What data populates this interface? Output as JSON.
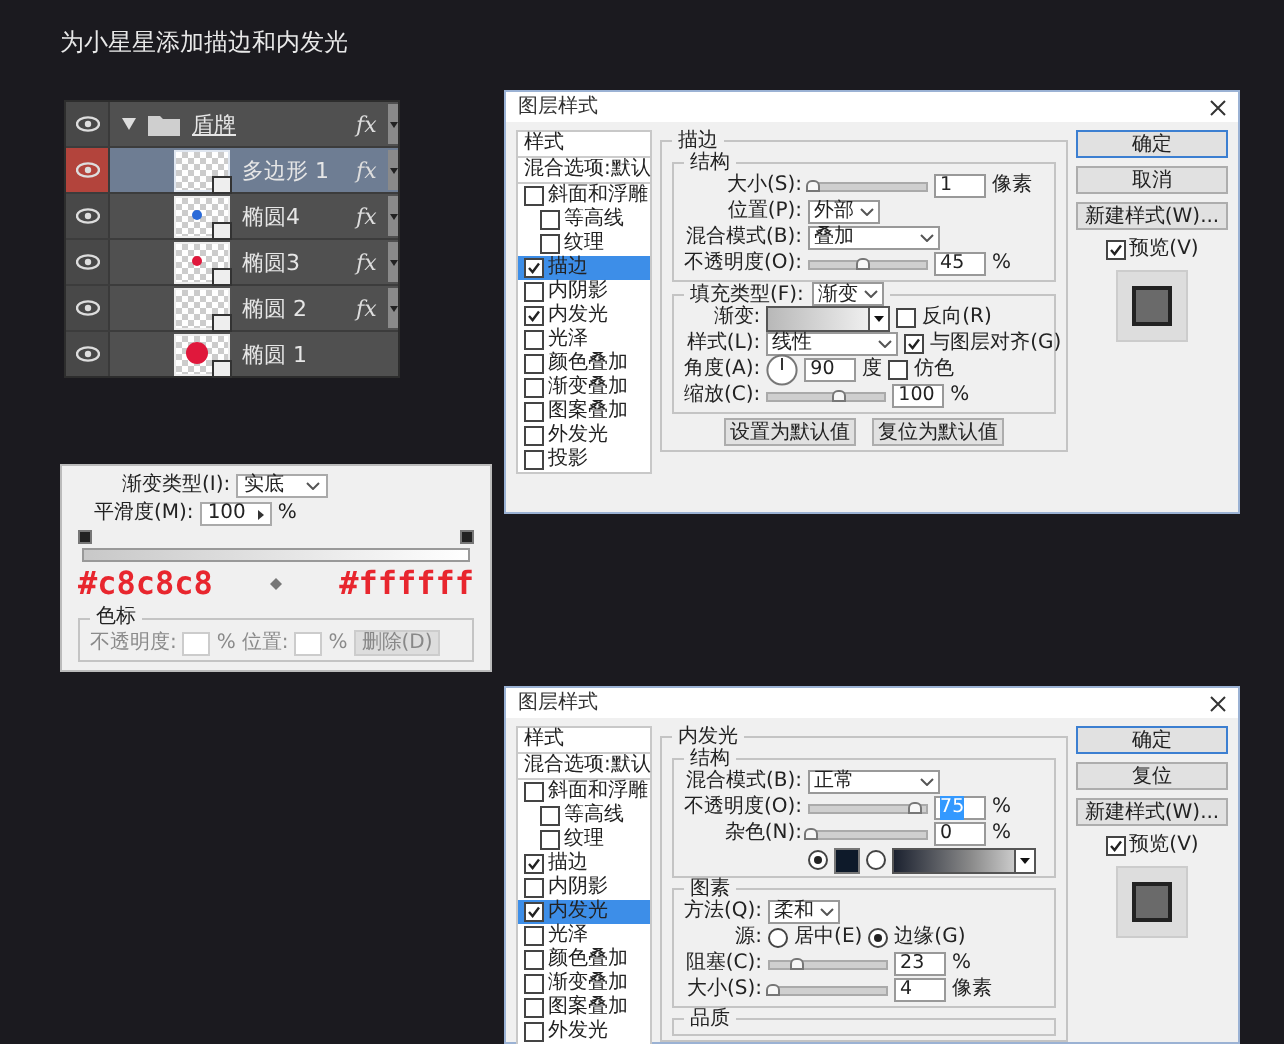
{
  "heading": "为小星星添加描边和内发光",
  "layers": [
    {
      "kind": "group",
      "name": "盾牌",
      "expanded": true,
      "selected": false,
      "fx": "fx",
      "children": [
        {
          "kind": "layer",
          "name": "多边形 1",
          "selected": true,
          "fx": "fx",
          "thumbnail": {
            "kind": "shape"
          }
        },
        {
          "kind": "layer",
          "name": "椭圆4",
          "selected": false,
          "fx": "fx",
          "thumbnail": {
            "kind": "dot",
            "color": "#2a6ad8"
          }
        },
        {
          "kind": "layer",
          "name": "椭圆3",
          "selected": false,
          "fx": "fx",
          "thumbnail": {
            "kind": "dot",
            "color": "#e0183c"
          }
        },
        {
          "kind": "layer",
          "name": "椭圆 2",
          "selected": false,
          "fx": "fx",
          "thumbnail": {
            "kind": "blank"
          }
        },
        {
          "kind": "layer",
          "name": "椭圆 1",
          "selected": false,
          "thumbnail": {
            "kind": "disc",
            "color": "#e0183c"
          }
        }
      ]
    }
  ],
  "gradient_editor": {
    "type_label": "渐变类型(I):",
    "type_value": "实底",
    "smoothness_label": "平滑度(M):",
    "smoothness_value": "100",
    "smoothness_unit": "%",
    "start_color": "#c8c8c8",
    "end_color": "#ffffff",
    "stops_legend": "色标",
    "opacity_label": "不透明度:",
    "opacity_unit": "%",
    "location_label": "位置:",
    "location_unit": "%",
    "delete_button": "删除(D)"
  },
  "dialogs": [
    {
      "title": "图层样式",
      "styles": [
        {
          "kind": "header",
          "label": "样式",
          "selected": false
        },
        {
          "kind": "header",
          "label": "混合选项:默认",
          "selected": false
        },
        {
          "kind": "checkbox",
          "label": "斜面和浮雕",
          "checked": false,
          "selected": false,
          "children": [
            {
              "kind": "checkbox",
              "label": "等高线",
              "checked": false,
              "selected": false
            },
            {
              "kind": "checkbox",
              "label": "纹理",
              "checked": false,
              "selected": false
            }
          ]
        },
        {
          "kind": "checkbox",
          "label": "描边",
          "checked": true,
          "selected": true
        },
        {
          "kind": "checkbox",
          "label": "内阴影",
          "checked": false,
          "selected": false
        },
        {
          "kind": "checkbox",
          "label": "内发光",
          "checked": true,
          "selected": false
        },
        {
          "kind": "checkbox",
          "label": "光泽",
          "checked": false,
          "selected": false
        },
        {
          "kind": "checkbox",
          "label": "颜色叠加",
          "checked": false,
          "selected": false
        },
        {
          "kind": "checkbox",
          "label": "渐变叠加",
          "checked": false,
          "selected": false
        },
        {
          "kind": "checkbox",
          "label": "图案叠加",
          "checked": false,
          "selected": false
        },
        {
          "kind": "checkbox",
          "label": "外发光",
          "checked": false,
          "selected": false
        },
        {
          "kind": "checkbox",
          "label": "投影",
          "checked": false,
          "selected": false
        }
      ],
      "panel": {
        "legend": "描边",
        "sections": [
          {
            "legend": "结构",
            "rows": [
              {
                "label": "大小(S):",
                "controls": [
                  {
                    "kind": "slider",
                    "level": 0.02
                  },
                  {
                    "kind": "input",
                    "value": "1",
                    "highlighted": false
                  },
                  {
                    "kind": "unit",
                    "text": "像素"
                  }
                ]
              },
              {
                "label": "位置(P):",
                "controls": [
                  {
                    "kind": "select",
                    "value": "外部"
                  }
                ]
              },
              {
                "label": "混合模式(B):",
                "controls": [
                  {
                    "kind": "wideselect",
                    "value": "叠加"
                  }
                ]
              },
              {
                "label": "不透明度(O):",
                "controls": [
                  {
                    "kind": "slider",
                    "level": 0.45
                  },
                  {
                    "kind": "input",
                    "value": "45",
                    "highlighted": false
                  },
                  {
                    "kind": "unit",
                    "text": "%"
                  }
                ]
              }
            ]
          },
          {
            "legend": "填充类型(F):",
            "legend_select": "渐变",
            "rows": [
              {
                "label": "渐变:",
                "controls": [
                  {
                    "kind": "gradient"
                  },
                  {
                    "kind": "checkbox",
                    "label": "反向(R)",
                    "checked": false
                  }
                ]
              },
              {
                "label": "样式(L):",
                "controls": [
                  {
                    "kind": "wideselect",
                    "value": "线性"
                  },
                  {
                    "kind": "checkbox",
                    "label": "与图层对齐(G)",
                    "checked": true
                  }
                ]
              },
              {
                "label": "角度(A):",
                "controls": [
                  {
                    "kind": "dial"
                  },
                  {
                    "kind": "input",
                    "value": "90",
                    "highlighted": false
                  },
                  {
                    "kind": "unit",
                    "text": "度"
                  },
                  {
                    "kind": "checkbox",
                    "label": "仿色",
                    "checked": false
                  }
                ]
              },
              {
                "label": "缩放(C):",
                "controls": [
                  {
                    "kind": "slider",
                    "level": 0.6
                  },
                  {
                    "kind": "input",
                    "value": "100",
                    "highlighted": false
                  },
                  {
                    "kind": "unit",
                    "text": "%"
                  }
                ]
              }
            ]
          }
        ],
        "buttons": [
          "设置为默认值",
          "复位为默认值"
        ]
      },
      "actions": [
        {
          "label": "确定",
          "default": true
        },
        {
          "label": "取消",
          "default": false
        },
        {
          "label": "新建样式(W)...",
          "default": false
        }
      ],
      "preview": {
        "label": "预览(V)",
        "checked": true
      }
    },
    {
      "title": "图层样式",
      "styles": [
        {
          "kind": "header",
          "label": "样式",
          "selected": false
        },
        {
          "kind": "header",
          "label": "混合选项:默认",
          "selected": false
        },
        {
          "kind": "checkbox",
          "label": "斜面和浮雕",
          "checked": false,
          "selected": false,
          "children": [
            {
              "kind": "checkbox",
              "label": "等高线",
              "checked": false,
              "selected": false
            },
            {
              "kind": "checkbox",
              "label": "纹理",
              "checked": false,
              "selected": false
            }
          ]
        },
        {
          "kind": "checkbox",
          "label": "描边",
          "checked": true,
          "selected": false
        },
        {
          "kind": "checkbox",
          "label": "内阴影",
          "checked": false,
          "selected": false
        },
        {
          "kind": "checkbox",
          "label": "内发光",
          "checked": true,
          "selected": true
        },
        {
          "kind": "checkbox",
          "label": "光泽",
          "checked": false,
          "selected": false
        },
        {
          "kind": "checkbox",
          "label": "颜色叠加",
          "checked": false,
          "selected": false
        },
        {
          "kind": "checkbox",
          "label": "渐变叠加",
          "checked": false,
          "selected": false
        },
        {
          "kind": "checkbox",
          "label": "图案叠加",
          "checked": false,
          "selected": false
        },
        {
          "kind": "checkbox",
          "label": "外发光",
          "checked": false,
          "selected": false
        }
      ],
      "panel": {
        "legend": "内发光",
        "sections": [
          {
            "legend": "结构",
            "rows": [
              {
                "label": "混合模式(B):",
                "controls": [
                  {
                    "kind": "wideselect",
                    "value": "正常"
                  }
                ]
              },
              {
                "label": "不透明度(O):",
                "controls": [
                  {
                    "kind": "slider",
                    "level": 0.9
                  },
                  {
                    "kind": "input",
                    "value": "75",
                    "highlighted": true
                  },
                  {
                    "kind": "unit",
                    "text": "%"
                  }
                ]
              },
              {
                "label": "杂色(N):",
                "controls": [
                  {
                    "kind": "slider",
                    "level": 0
                  },
                  {
                    "kind": "input",
                    "value": "0",
                    "highlighted": false
                  },
                  {
                    "kind": "unit",
                    "text": "%"
                  }
                ]
              },
              {
                "controls": [
                  {
                    "kind": "radio",
                    "selected": true
                  },
                  {
                    "kind": "swatch",
                    "color": "#0e1a2a"
                  },
                  {
                    "kind": "radio",
                    "selected": false
                  },
                  {
                    "kind": "darkgradient"
                  }
                ]
              }
            ]
          },
          {
            "legend": "图素",
            "rows": [
              {
                "label": "方法(Q):",
                "controls": [
                  {
                    "kind": "select",
                    "value": "柔和"
                  }
                ]
              },
              {
                "label": "源:",
                "controls": [
                  {
                    "kind": "radio",
                    "label": "居中(E)",
                    "selected": false
                  },
                  {
                    "kind": "radio",
                    "label": "边缘(G)",
                    "selected": true
                  }
                ]
              },
              {
                "label": "阻塞(C):",
                "controls": [
                  {
                    "kind": "slider",
                    "level": 0.23
                  },
                  {
                    "kind": "input",
                    "value": "23",
                    "highlighted": false
                  },
                  {
                    "kind": "unit",
                    "text": "%"
                  }
                ]
              },
              {
                "label": "大小(S):",
                "controls": [
                  {
                    "kind": "slider",
                    "level": 0.02
                  },
                  {
                    "kind": "input",
                    "value": "4",
                    "highlighted": false
                  },
                  {
                    "kind": "unit",
                    "text": "像素"
                  }
                ]
              }
            ]
          },
          {
            "legend": "品质"
          }
        ]
      },
      "actions": [
        {
          "label": "确定",
          "default": true
        },
        {
          "label": "复位",
          "default": false
        },
        {
          "label": "新建样式(W)...",
          "default": false
        }
      ],
      "preview": {
        "label": "预览(V)",
        "checked": true
      }
    }
  ]
}
